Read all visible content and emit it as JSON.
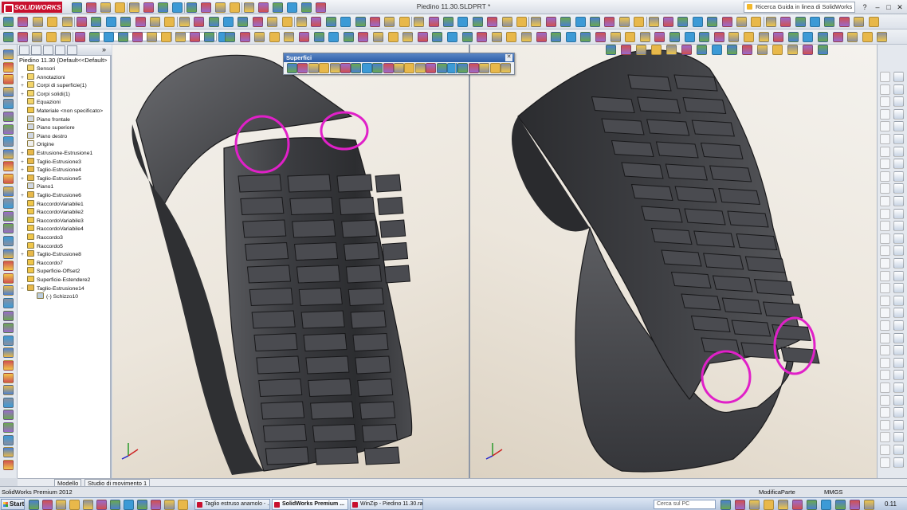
{
  "app": {
    "logo": "SOLIDWORKS",
    "doc_title": "Piedino 11.30.SLDPRT *",
    "help_search": "Ricerca Guida in linea di SolidWorks"
  },
  "tree": {
    "root": "Piedino 11.30  (Default<<Default>",
    "items": [
      {
        "label": "Sensori",
        "plus": false,
        "icon": "sensor-folder-icon"
      },
      {
        "label": "Annotazioni",
        "plus": true,
        "icon": "annotations-icon"
      },
      {
        "label": "Corpi di superficie(1)",
        "plus": true,
        "icon": "surface-bodies-icon"
      },
      {
        "label": "Corpi solidi(1)",
        "plus": true,
        "icon": "solid-bodies-icon"
      },
      {
        "label": "Equazioni",
        "plus": false,
        "icon": "equations-icon"
      },
      {
        "label": "Materiale <non specificato>",
        "plus": false,
        "icon": "material-icon"
      },
      {
        "label": "Piano frontale",
        "plus": false,
        "icon": "plane-icon"
      },
      {
        "label": "Piano superiore",
        "plus": false,
        "icon": "plane-icon"
      },
      {
        "label": "Piano destro",
        "plus": false,
        "icon": "plane-icon"
      },
      {
        "label": "Origine",
        "plus": false,
        "icon": "origin-icon"
      },
      {
        "label": "Estrusione-Estrusione1",
        "plus": true,
        "icon": "extrude-icon"
      },
      {
        "label": "Taglio-Estrusione3",
        "plus": true,
        "icon": "cut-extrude-icon"
      },
      {
        "label": "Taglio-Estrusione4",
        "plus": true,
        "icon": "cut-extrude-icon"
      },
      {
        "label": "Taglio-Estrusione5",
        "plus": true,
        "icon": "cut-extrude-icon"
      },
      {
        "label": "Piano1",
        "plus": false,
        "icon": "plane-icon"
      },
      {
        "label": "Taglio-Estrusione6",
        "plus": true,
        "icon": "cut-extrude-icon"
      },
      {
        "label": "RaccordoVariabile1",
        "plus": false,
        "icon": "fillet-icon"
      },
      {
        "label": "RaccordoVariabile2",
        "plus": false,
        "icon": "fillet-icon"
      },
      {
        "label": "RaccordoVariabile3",
        "plus": false,
        "icon": "fillet-icon"
      },
      {
        "label": "RaccordoVariabile4",
        "plus": false,
        "icon": "fillet-icon"
      },
      {
        "label": "Raccordo3",
        "plus": false,
        "icon": "fillet-icon"
      },
      {
        "label": "Raccordo5",
        "plus": false,
        "icon": "fillet-icon"
      },
      {
        "label": "Taglio-Estrusione8",
        "plus": true,
        "icon": "cut-extrude-icon"
      },
      {
        "label": "Raccordo7",
        "plus": false,
        "icon": "fillet-icon"
      },
      {
        "label": "Superficie-Offset2",
        "plus": false,
        "icon": "surface-offset-icon"
      },
      {
        "label": "Superficie-Estendere2",
        "plus": false,
        "icon": "surface-extend-icon"
      },
      {
        "label": "Taglio-Estrusione14",
        "plus": "minus",
        "icon": "cut-extrude-icon"
      },
      {
        "label": "(-) Schizzo10",
        "plus": false,
        "icon": "sketch-icon",
        "child": true
      }
    ]
  },
  "floating_toolbar": {
    "title": "Superfici"
  },
  "bottom_tabs": [
    "Modello",
    "Studio di movimento 1"
  ],
  "status": {
    "left": "SolidWorks Premium 2012",
    "mode": "ModificaParte",
    "units": "MMGS"
  },
  "taskbar": {
    "start": "Start",
    "tasks": [
      {
        "label": "Taglio estruso anamolo - ...",
        "active": false
      },
      {
        "label": "SolidWorks Premium ...",
        "active": true
      },
      {
        "label": "WinZip - Piedino 11.30.rar",
        "active": false
      }
    ],
    "search_placeholder": "Cerca sul PC",
    "clock": "0.11"
  },
  "colors": {
    "brand": "#c8102e",
    "highlight_circle": "#e020c8",
    "model_dark": "#3a3b3e"
  }
}
